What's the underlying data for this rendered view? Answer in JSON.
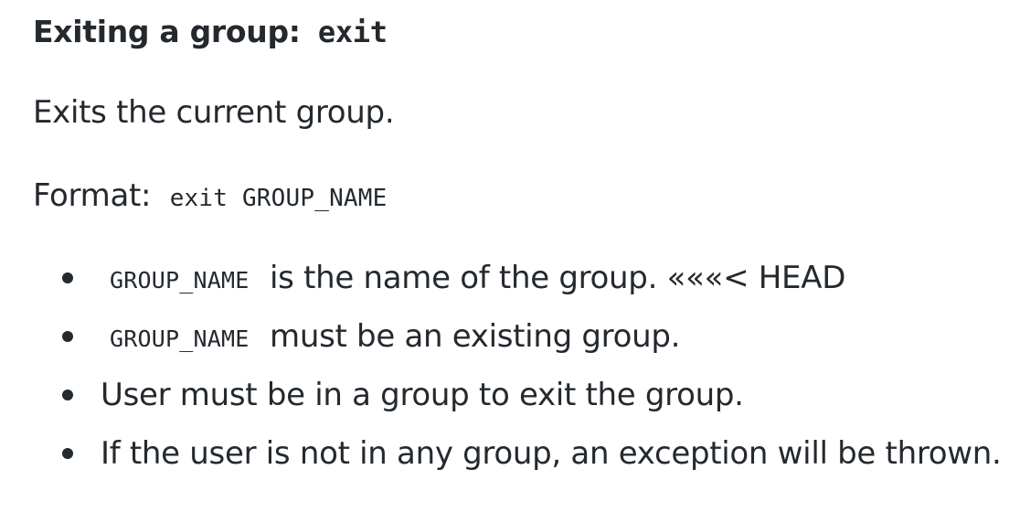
{
  "heading": {
    "text": "Exiting a group:",
    "command": "exit"
  },
  "description": "Exits the current group.",
  "format": {
    "label": "Format:",
    "syntax": "exit GROUP_NAME"
  },
  "bullets": [
    {
      "code": "GROUP_NAME",
      "text": "is the name of the group. «««< HEAD"
    },
    {
      "code": "GROUP_NAME",
      "text": "must be an existing group."
    },
    {
      "code": "",
      "text": "User must be in a group to exit the group."
    },
    {
      "code": "",
      "text": "If the user is not in any group, an exception will be thrown."
    }
  ]
}
